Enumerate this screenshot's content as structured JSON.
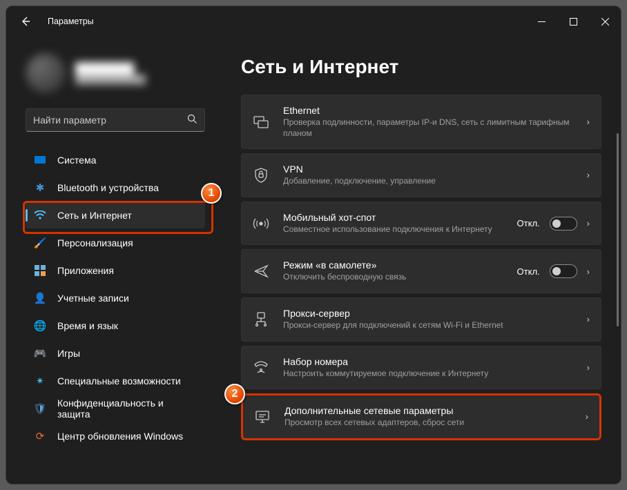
{
  "window": {
    "title": "Параметры"
  },
  "search": {
    "placeholder": "Найти параметр"
  },
  "nav": {
    "items": [
      {
        "label": "Система"
      },
      {
        "label": "Bluetooth и устройства"
      },
      {
        "label": "Сеть и Интернет"
      },
      {
        "label": "Персонализация"
      },
      {
        "label": "Приложения"
      },
      {
        "label": "Учетные записи"
      },
      {
        "label": "Время и язык"
      },
      {
        "label": "Игры"
      },
      {
        "label": "Специальные возможности"
      },
      {
        "label": "Конфиденциальность и защита"
      },
      {
        "label": "Центр обновления Windows"
      }
    ]
  },
  "page": {
    "title": "Сеть и Интернет"
  },
  "cards": {
    "ethernet": {
      "title": "Ethernet",
      "sub": "Проверка подлинности, параметры IP-и DNS, сеть с лимитным тарифным планом"
    },
    "vpn": {
      "title": "VPN",
      "sub": "Добавление, подключение, управление"
    },
    "hotspot": {
      "title": "Мобильный хот-спот",
      "sub": "Совместное использование подключения к Интернету",
      "state": "Откл."
    },
    "airplane": {
      "title": "Режим «в самолете»",
      "sub": "Отключить беспроводную связь",
      "state": "Откл."
    },
    "proxy": {
      "title": "Прокси-сервер",
      "sub": "Прокси-сервер для подключений к сетям Wi-Fi и Ethernet"
    },
    "dialup": {
      "title": "Набор номера",
      "sub": "Настроить коммутируемое подключение к Интернету"
    },
    "advanced": {
      "title": "Дополнительные сетевые параметры",
      "sub": "Просмотр всех сетевых адаптеров, сброс сети"
    }
  },
  "callouts": {
    "one": "1",
    "two": "2"
  }
}
